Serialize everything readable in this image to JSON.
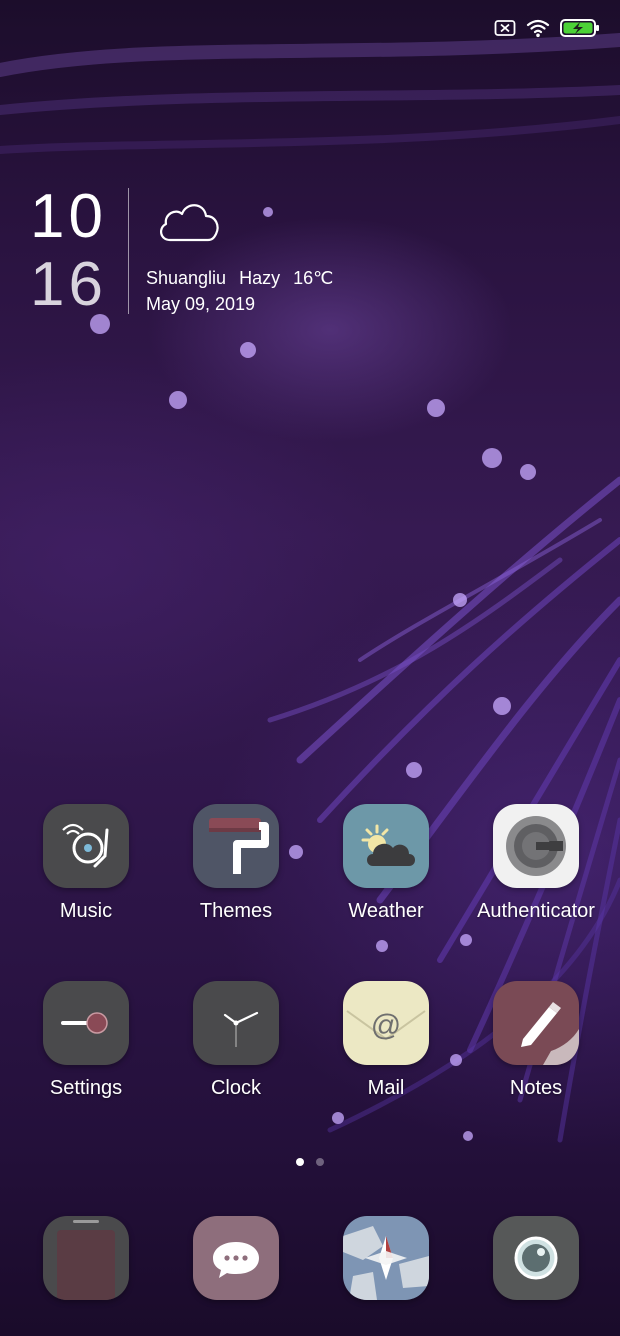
{
  "status_bar": {
    "icons": [
      "no-sim-icon",
      "wifi-icon",
      "battery-charging-icon"
    ]
  },
  "clock_widget": {
    "hour": "10",
    "minute": "16",
    "weather_icon": "cloud-icon",
    "location": "Shuangliu",
    "condition": "Hazy",
    "temperature": "16℃",
    "date": "May  09, 2019"
  },
  "apps": [
    {
      "label": "Music",
      "icon": "music-turntable-icon"
    },
    {
      "label": "Themes",
      "icon": "paint-roller-icon"
    },
    {
      "label": "Weather",
      "icon": "sun-cloud-icon"
    },
    {
      "label": "Authenticator",
      "icon": "authenticator-g-icon"
    },
    {
      "label": "Settings",
      "icon": "toggle-switch-icon"
    },
    {
      "label": "Clock",
      "icon": "clock-face-icon"
    },
    {
      "label": "Mail",
      "icon": "envelope-at-icon"
    },
    {
      "label": "Notes",
      "icon": "pencil-icon"
    }
  ],
  "page_indicator": {
    "pages": 2,
    "current": 1
  },
  "dock": [
    {
      "icon": "phone-icon"
    },
    {
      "icon": "messages-icon"
    },
    {
      "icon": "compass-browser-icon"
    },
    {
      "icon": "camera-icon"
    }
  ],
  "colors": {
    "wallpaper": "#2a1340",
    "accent_purple": "#7a4cc8",
    "battery_green": "#4cd137"
  }
}
